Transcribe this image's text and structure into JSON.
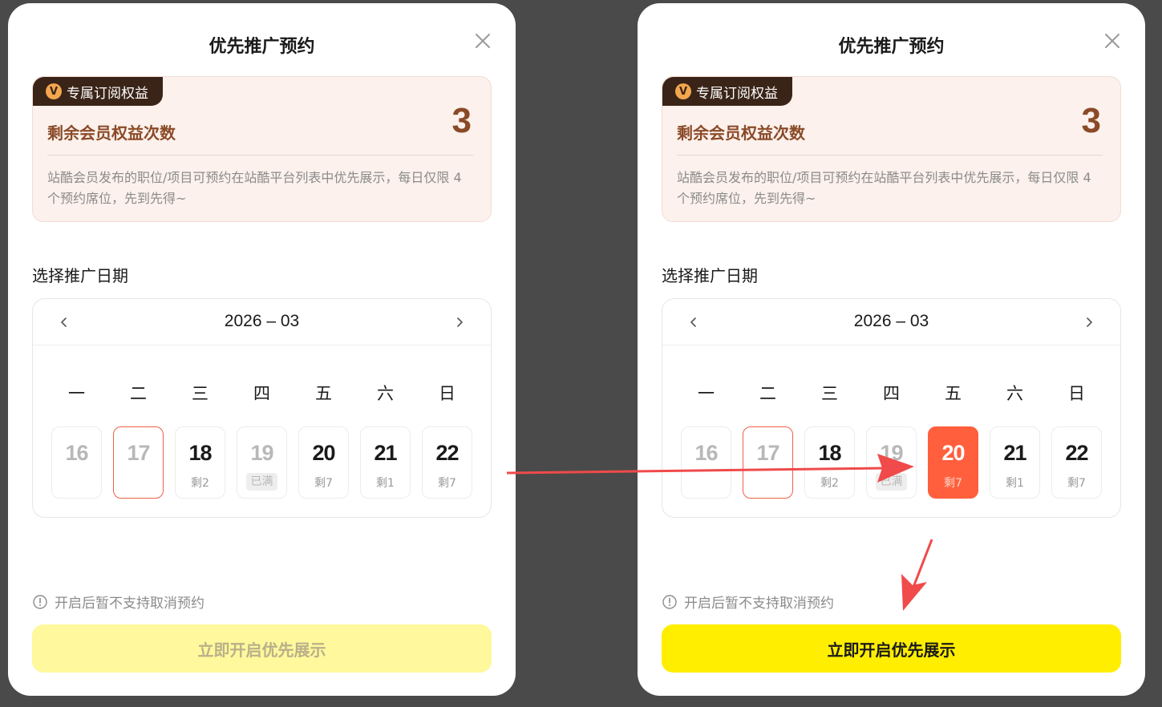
{
  "modal": {
    "title": "优先推广预约",
    "benefit_tag": "专属订阅权益",
    "benefit_badge": "V",
    "benefit_label": "剩余会员权益次数",
    "benefit_count": "3",
    "benefit_desc": "站酷会员发布的职位/项目可预约在站酷平台列表中优先展示，每日仅限 4 个预约席位，先到先得~",
    "date_section_label": "选择推广日期",
    "notice": "开启后暂不支持取消预约",
    "cta_label": "立即开启优先展示"
  },
  "calendar": {
    "month": "2026 – 03",
    "weekdays": [
      "一",
      "二",
      "三",
      "四",
      "五",
      "六",
      "日"
    ],
    "days": [
      {
        "num": "16",
        "remain": "",
        "state": "past"
      },
      {
        "num": "17",
        "remain": "",
        "state": "today"
      },
      {
        "num": "18",
        "remain": "剩2",
        "state": "available"
      },
      {
        "num": "19",
        "remain": "已满",
        "state": "full"
      },
      {
        "num": "20",
        "remain": "剩7",
        "state": "available"
      },
      {
        "num": "21",
        "remain": "剩1",
        "state": "available"
      },
      {
        "num": "22",
        "remain": "剩7",
        "state": "available"
      }
    ]
  },
  "panels": [
    {
      "selected_day": "",
      "cta_state": "disabled"
    },
    {
      "selected_day": "20",
      "cta_state": "enabled"
    }
  ],
  "colors": {
    "accent_selected": "#ff5f3d",
    "today_border": "#f06048",
    "cta_enabled": "#ffee00",
    "cta_disabled": "#fff89c",
    "annotation_arrow": "#f04a4a"
  },
  "icons": {
    "close": "close-icon",
    "prev": "chevron-left-icon",
    "next": "chevron-right-icon",
    "notice": "info-circle-icon",
    "badge": "vip-badge-icon"
  }
}
